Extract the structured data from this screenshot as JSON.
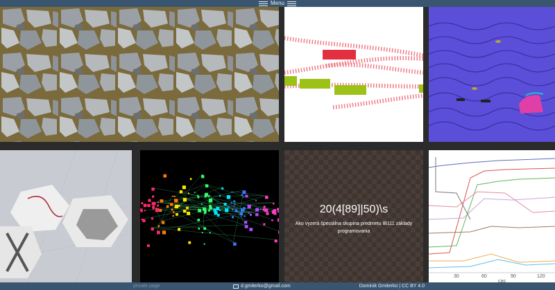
{
  "topbar": {
    "menu_label": "Menu",
    "icon": "hamburger-icon"
  },
  "tiles": {
    "t6": {
      "title": "20(4[89]|50)\\s",
      "subtitle": "Ako vyzerá špeciálna skupina predmetu IB111 základy programovania"
    },
    "t7": {
      "x_ticks": [
        "30",
        "60",
        "90",
        "120"
      ],
      "x_label": "cas"
    }
  },
  "footer": {
    "left_text": "private page",
    "email": "d.gmiterko@gmail.com",
    "credit": "Dominik Gmiterko | CC BY 4.0"
  },
  "colors": {
    "bar": "#3a5570",
    "gutter": "#2b2b2b"
  }
}
